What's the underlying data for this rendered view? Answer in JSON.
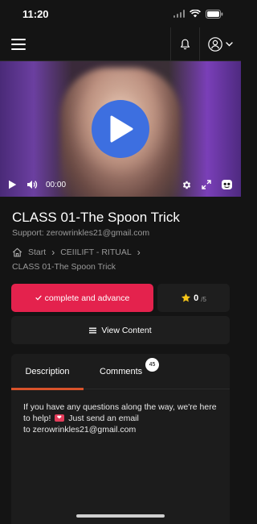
{
  "status_bar": {
    "time": "11:20"
  },
  "video": {
    "time": "00:00"
  },
  "lesson": {
    "title": "CLASS 01-The Spoon Trick",
    "support": "Support: zerowrinkles21@gmail.com"
  },
  "breadcrumb": {
    "start": "Start",
    "course": "CEIILIFT - RITUAL",
    "current": "CLASS 01-The Spoon Trick"
  },
  "actions": {
    "complete_label": "complete and advance",
    "rating_value": "0",
    "rating_max": "/5",
    "view_content_label": "View Content"
  },
  "tabs": {
    "description_label": "Description",
    "comments_label": "Comments",
    "comments_count": "45"
  },
  "description": {
    "line1": "If you have any questions along the way, we're here",
    "line2_before": "to help!",
    "line2_after": "Just send an email",
    "line3": "to zerowrinkles21@gmail.com"
  },
  "colors": {
    "accent": "#e4224d",
    "play_button": "#3d6fe0",
    "tab_underline": "#d9532b",
    "star": "#f5c518"
  }
}
